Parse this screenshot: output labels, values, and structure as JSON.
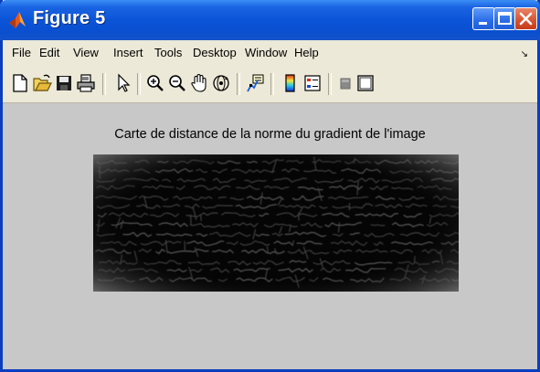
{
  "window": {
    "title": "Figure 5",
    "icons": [
      "matlab-logo-icon",
      "minimize-icon",
      "maximize-icon",
      "close-icon"
    ]
  },
  "menu": {
    "items": [
      "File",
      "Edit",
      "View",
      "Insert",
      "Tools",
      "Desktop",
      "Window",
      "Help"
    ],
    "overflow_arrow": "↘"
  },
  "toolbar": {
    "icons": [
      "new-figure-icon",
      "open-file-icon",
      "save-icon",
      "print-icon",
      "edit-plot-arrow-icon",
      "zoom-in-icon",
      "zoom-out-icon",
      "pan-hand-icon",
      "rotate-3d-icon",
      "data-cursor-icon",
      "insert-colorbar-icon",
      "insert-legend-icon",
      "hide-plot-tools-icon",
      "show-plot-tools-icon"
    ]
  },
  "figure": {
    "title": "Carte de distance de la norme du gradient de l'image",
    "background": "#c8c8c8",
    "image_description_colors": [
      "#000000",
      "#3a3a3a",
      "#9a9a9a"
    ]
  }
}
